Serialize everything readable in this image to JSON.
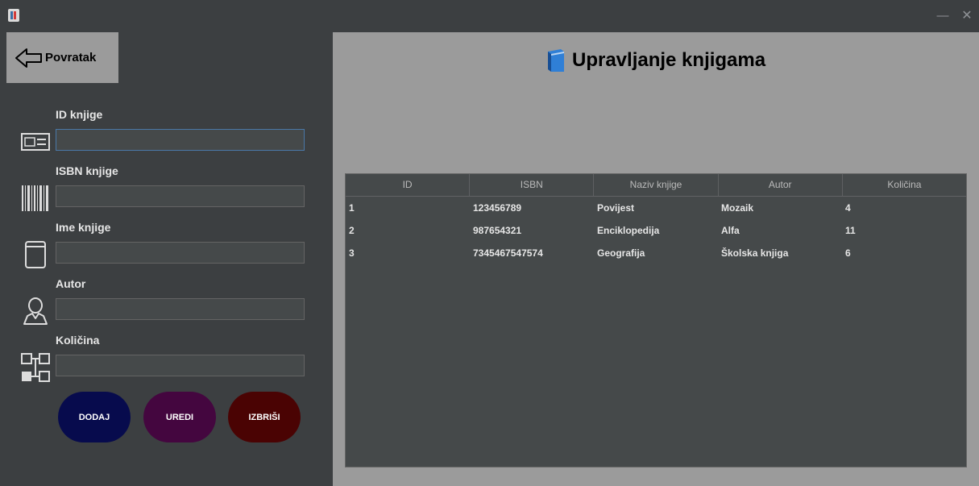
{
  "window": {
    "minimize_glyph": "—",
    "close_glyph": "✕"
  },
  "back_button": {
    "label": "Povratak"
  },
  "form": {
    "fields": [
      {
        "label": "ID knjige",
        "value": ""
      },
      {
        "label": "ISBN knjige",
        "value": ""
      },
      {
        "label": "Ime knjige",
        "value": ""
      },
      {
        "label": "Autor",
        "value": ""
      },
      {
        "label": "Količina",
        "value": ""
      }
    ],
    "buttons": {
      "add": "DODAJ",
      "edit": "UREDI",
      "delete": "IZBRIŠI"
    }
  },
  "main": {
    "title": "Upravljanje knjigama",
    "table": {
      "columns": [
        "ID",
        "ISBN",
        "Naziv knjige",
        "Autor",
        "Količina"
      ],
      "rows": [
        [
          "1",
          "123456789",
          "Povijest",
          "Mozaik",
          "4"
        ],
        [
          "2",
          "987654321",
          "Enciklopedija",
          "Alfa",
          "11"
        ],
        [
          "3",
          "7345467547574",
          "Geografija",
          "Školska knjiga",
          "6"
        ]
      ]
    }
  },
  "colors": {
    "add_button": "#070b4d",
    "edit_button": "#44063f",
    "delete_button": "#4a0303",
    "panel_dark": "#3c3f41",
    "panel_light": "#9b9b9b"
  },
  "icons": {
    "app": "app-icon",
    "back": "arrow-left-icon",
    "id": "id-card-icon",
    "isbn": "barcode-icon",
    "name": "book-icon",
    "author": "user-icon",
    "quantity": "hierarchy-icon",
    "title": "blue-book-icon"
  }
}
